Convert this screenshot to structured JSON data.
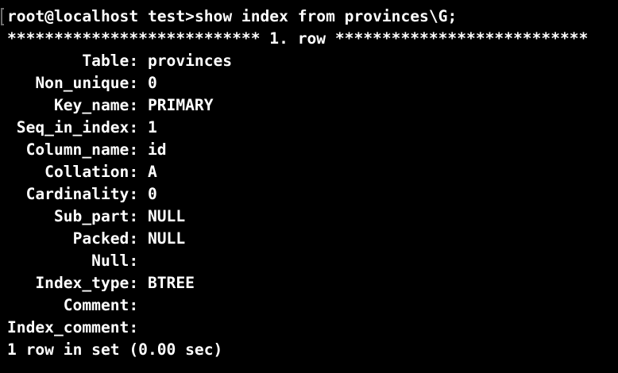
{
  "terminal": {
    "prompt": "root@localhost test>",
    "command": "show index from provinces\\G;",
    "row_header": "*************************** 1. row ***************************",
    "fields": [
      {
        "name": "Table",
        "value": "provinces"
      },
      {
        "name": "Non_unique",
        "value": "0"
      },
      {
        "name": "Key_name",
        "value": "PRIMARY"
      },
      {
        "name": "Seq_in_index",
        "value": "1"
      },
      {
        "name": "Column_name",
        "value": "id"
      },
      {
        "name": "Collation",
        "value": "A"
      },
      {
        "name": "Cardinality",
        "value": "0"
      },
      {
        "name": "Sub_part",
        "value": "NULL"
      },
      {
        "name": "Packed",
        "value": "NULL"
      },
      {
        "name": "Null",
        "value": ""
      },
      {
        "name": "Index_type",
        "value": "BTREE"
      },
      {
        "name": "Comment",
        "value": ""
      },
      {
        "name": "Index_comment",
        "value": ""
      }
    ],
    "footer": "1 row in set (0.00 sec)"
  }
}
